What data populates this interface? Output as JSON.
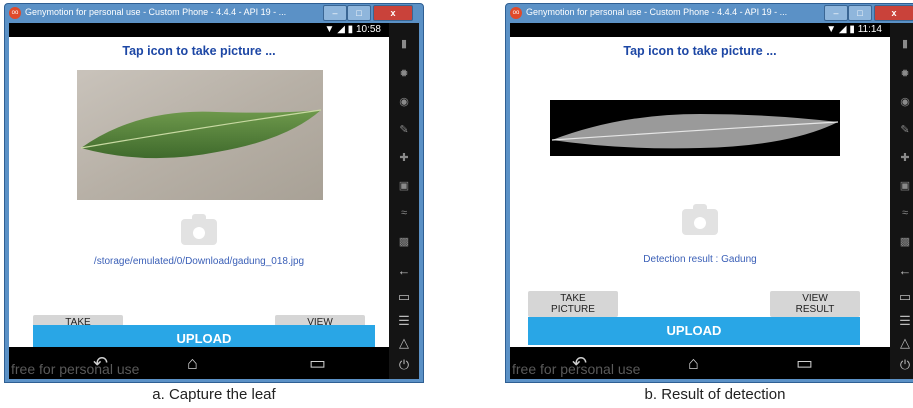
{
  "window": {
    "title": "Genymotion for personal use - Custom Phone - 4.4.4 - API 19 - ...",
    "minimize_symbol": "–",
    "maximize_symbol": "□",
    "close_symbol": "x"
  },
  "panels": [
    {
      "status_time": "10:58",
      "heading": "Tap icon to take picture ...",
      "info_text": "/storage/emulated/0/Download/gadung_018.jpg",
      "take_picture_label": "TAKE\nPICTURE",
      "view_result_label": "VIEW\nRESULT",
      "upload_label": "UPLOAD",
      "watermark": "free for personal use",
      "caption": "a. Capture the leaf"
    },
    {
      "status_time": "11:14",
      "heading": "Tap icon to take picture ...",
      "info_text": "Detection result : Gadung",
      "take_picture_label": "TAKE\nPICTURE",
      "view_result_label": "VIEW\nRESULT",
      "upload_label": "UPLOAD",
      "watermark": "free for personal use",
      "caption": "b. Result of detection"
    }
  ],
  "colors": {
    "heading": "#1d47a5",
    "upload": "#29a6e6",
    "title_bar": "#5b91c6",
    "close": "#c9423a"
  },
  "icons": {
    "camera": "camera-icon",
    "back": "back-icon",
    "home": "home-icon",
    "recents": "recents-icon",
    "signal": "signal-icon",
    "battery": "battery-icon"
  }
}
